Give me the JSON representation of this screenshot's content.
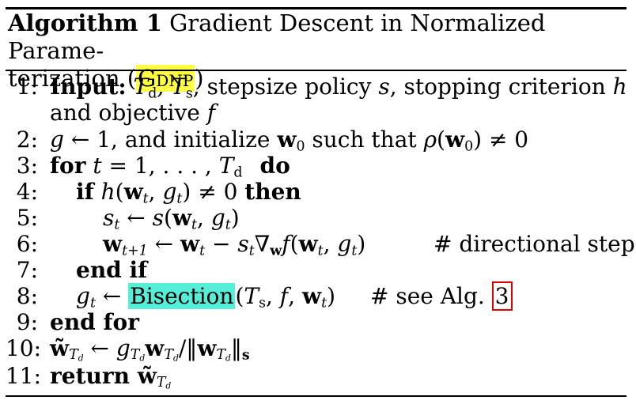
{
  "caption": {
    "label": "Algorithm 1",
    "title_pre": "Gradient Descent in Normalized Parame-",
    "title_post": "terization (",
    "abbrev": "Gdnp",
    "close": ")"
  },
  "lines": [
    {
      "n": "1:",
      "k1": "Input:",
      "t1": " T",
      "s1": "d",
      "t2": ", T",
      "s2": "s",
      "t3": ", stepsize policy ",
      "t4": "s",
      "t5": ", stopping criterion ",
      "t6": "h"
    },
    {
      "t1": "and objective ",
      "t2": "f"
    },
    {
      "n": "2:",
      "t1": "g",
      "t2": " ← 1, and initialize ",
      "b1": "w",
      "s1": "0",
      "t3": " such that ",
      "t4": "ρ",
      "t5": "(",
      "b2": "w",
      "s2": "0",
      "t6": ") ≠ 0"
    },
    {
      "n": "3:",
      "k1": "for",
      "t1": " t",
      "t2": " = 1, . . . , ",
      "t3": "T",
      "s1": "d",
      "k2": "do"
    },
    {
      "n": "4:",
      "k1": "if",
      "t1": " h",
      "t2": "(",
      "b1": "w",
      "s1": "t",
      "t3": ", ",
      "t4": "g",
      "s2": "t",
      "t5": ") ≠ 0 ",
      "k2": "then"
    },
    {
      "n": "5:",
      "t1": "s",
      "s1": "t",
      "t2": " ← ",
      "t3": "s",
      "t4": "(",
      "b1": "w",
      "s2": "t",
      "t5": ", ",
      "t6": "g",
      "s3": "t",
      "t7": ")"
    },
    {
      "n": "6:",
      "b1": "w",
      "s1": "t+1",
      "t2": " ← ",
      "b2": "w",
      "s2": "t",
      "t3": " − ",
      "t4": "s",
      "s3": "t",
      "t5": "∇",
      "s4": "w",
      "t6": "f",
      "t7": "(",
      "b3": "w",
      "s5": "t",
      "t8": ", ",
      "t9": "g",
      "s6": "t",
      "t10": ")",
      "comment": "# directional step"
    },
    {
      "n": "7:",
      "k1": "end if"
    },
    {
      "n": "8:",
      "t1": "g",
      "s1": "t",
      "t2": " ← ",
      "hl": "Bisection",
      "t3": "(",
      "t4": "T",
      "s2": "s",
      "t5": ", ",
      "t6": "f",
      "t7": ", ",
      "b1": "w",
      "s3": "t",
      "t8": ")",
      "comment": "# see Alg. ",
      "ref": "3"
    },
    {
      "n": "9:",
      "k1": "end for"
    },
    {
      "n": "10:",
      "b1": "w̃",
      "s1": "T",
      "ss1": "d",
      "t2": " ← ",
      "t3": "g",
      "s2": "T",
      "ss2": "d",
      "b2": "w",
      "s3": "T",
      "ss3": "d",
      "t4": "/‖",
      "b3": "w",
      "s4": "T",
      "ss4": "d",
      "t5": "‖",
      "s5": "s"
    },
    {
      "n": "11:",
      "k1": "return",
      "b1": " w̃",
      "s1": "T",
      "ss1": "d"
    }
  ]
}
